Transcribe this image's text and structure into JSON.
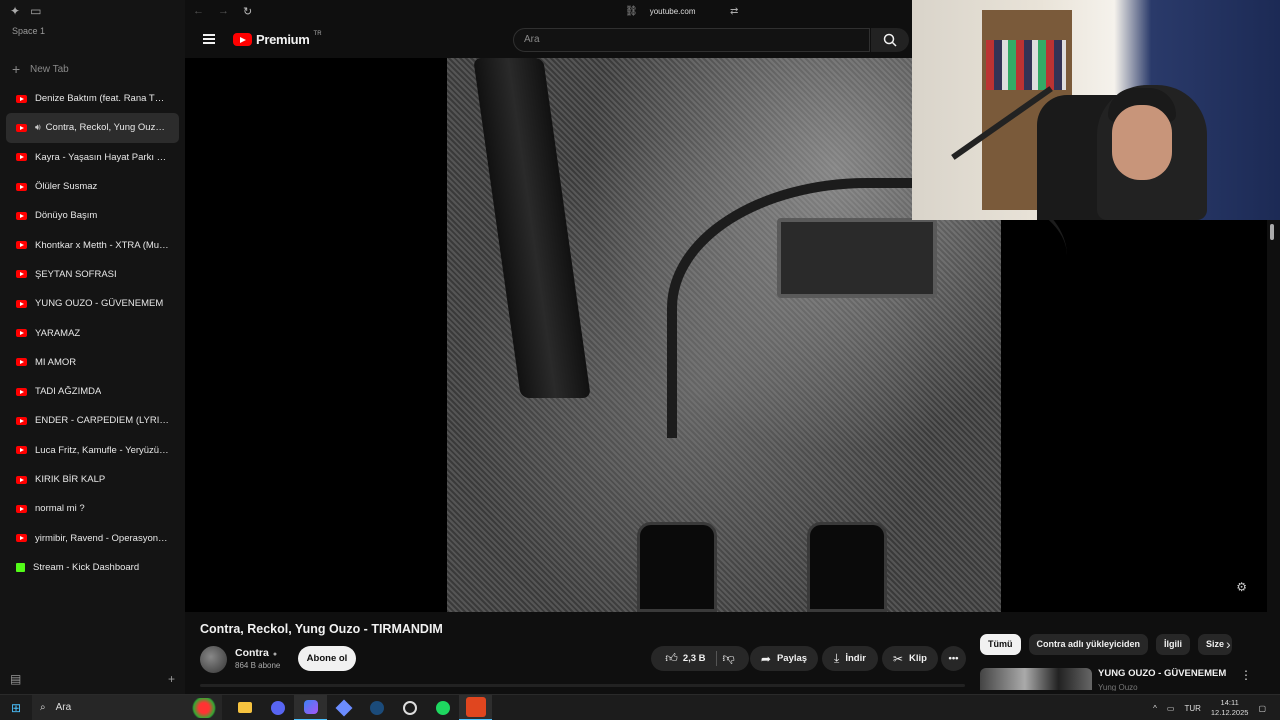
{
  "browser": {
    "space_label": "Space 1",
    "new_tab_label": "New Tab",
    "url": "youtube.com"
  },
  "sidebar": {
    "tabs": [
      {
        "title": "Denize Baktım (feat. Rana Türkyıl...",
        "icon": "youtube-icon",
        "active": false
      },
      {
        "title": "Contra, Reckol, Yung Ouzo -...",
        "icon": "youtube-icon",
        "active": true,
        "audio": true
      },
      {
        "title": "Kayra - Yaşasın Hayat Parkı Fanzi...",
        "icon": "youtube-icon",
        "active": false
      },
      {
        "title": "Ölüler Susmaz",
        "icon": "youtube-icon",
        "active": false
      },
      {
        "title": "Dönüyo Başım",
        "icon": "youtube-icon",
        "active": false
      },
      {
        "title": "Khontkar x Metth - XTRA (Music...",
        "icon": "youtube-icon",
        "active": false
      },
      {
        "title": "ŞEYTAN SOFRASI",
        "icon": "youtube-icon",
        "active": false
      },
      {
        "title": "YUNG OUZO - GÜVENEMEM",
        "icon": "youtube-icon",
        "active": false
      },
      {
        "title": "YARAMAZ",
        "icon": "youtube-icon",
        "active": false
      },
      {
        "title": "MI AMOR",
        "icon": "youtube-icon",
        "active": false
      },
      {
        "title": "TADI AĞZIMDA",
        "icon": "youtube-icon",
        "active": false
      },
      {
        "title": "ENDER - CARPEDIEM (LYRIC VID...",
        "icon": "youtube-icon",
        "active": false
      },
      {
        "title": "Luca Fritz, Kamufle - Yeryüzünde...",
        "icon": "youtube-icon",
        "active": false
      },
      {
        "title": "KIRIK BİR KALP",
        "icon": "youtube-icon",
        "active": false
      },
      {
        "title": "normal mi ?",
        "icon": "youtube-icon",
        "active": false
      },
      {
        "title": "yirmibir, Ravend - Operasyon (Of...",
        "icon": "youtube-icon",
        "active": false
      },
      {
        "title": "Stream - Kick Dashboard",
        "icon": "kick-icon",
        "active": false
      }
    ]
  },
  "youtube": {
    "logo_text": "Premium",
    "logo_country": "TR",
    "search_placeholder": "Ara",
    "video_title": "Contra, Reckol, Yung Ouzo - TIRMANDIM",
    "channel_name": "Contra",
    "subscribers": "864 B abone",
    "subscribe_label": "Abone ol",
    "like_count": "2,3 B",
    "share_label": "Paylaş",
    "download_label": "İndir",
    "clip_label": "Klip",
    "chips": [
      "Tümü",
      "Contra adlı yükleyiciden",
      "İlgili",
      "Size"
    ],
    "reco_title": "YUNG OUZO - GÜVENEMEM",
    "reco_channel": "Yung Ouzo"
  },
  "taskbar": {
    "search_label": "Ara",
    "language": "TUR",
    "time": "14:11",
    "date": "12.12.2025"
  },
  "colors": {
    "youtube_red": "#ff0000",
    "background": "#0f0f0f",
    "kick_green": "#53fc18",
    "accent_blue": "#4cc2ff"
  }
}
